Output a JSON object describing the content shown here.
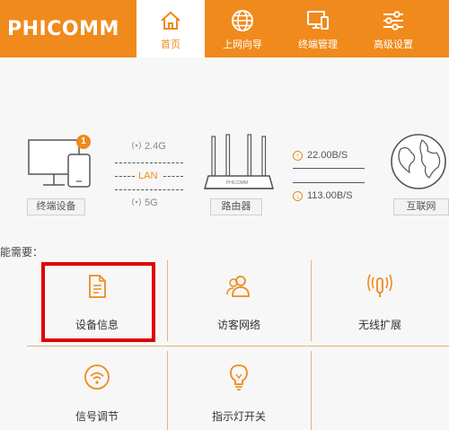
{
  "header": {
    "logo": "PHICOMM",
    "nav": [
      {
        "label": "首页",
        "icon": "home-icon",
        "active": true
      },
      {
        "label": "上网向导",
        "icon": "globe-icon"
      },
      {
        "label": "终端管理",
        "icon": "devices-icon"
      },
      {
        "label": "高级设置",
        "icon": "sliders-icon"
      }
    ]
  },
  "topology": {
    "terminal_label": "终端设备",
    "terminal_badge": "1",
    "band_24": "2.4G",
    "lan": "LAN",
    "band_5": "5G",
    "router_label": "路由器",
    "router_brand": "PHICOMM",
    "upload_speed": "22.00B/S",
    "download_speed": "113.00B/S",
    "internet_label": "互联网"
  },
  "section_label": "能需要：",
  "tiles": [
    {
      "label": "设备信息",
      "icon": "document-icon"
    },
    {
      "label": "访客网络",
      "icon": "guest-users-icon"
    },
    {
      "label": "无线扩展",
      "icon": "wireless-extend-icon"
    },
    {
      "label": "信号调节",
      "icon": "signal-adjust-icon"
    },
    {
      "label": "指示灯开关",
      "icon": "lightbulb-icon"
    }
  ],
  "colors": {
    "accent": "#f08a1c",
    "highlight": "#e00000"
  }
}
